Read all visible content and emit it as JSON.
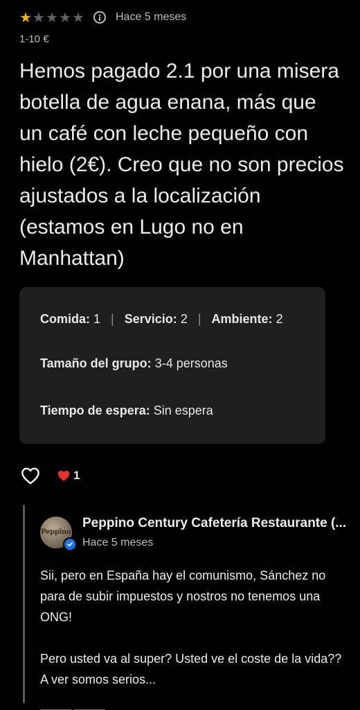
{
  "review": {
    "rating": 1,
    "max_rating": 5,
    "time_ago": "Hace 5 meses",
    "price_range": "1-10 €",
    "text": "Hemos pagado 2.1 por una misera botella de agua enana, más que un café con leche pequeño con hielo (2€). Creo que no son precios ajustados a la localización (estamos en Lugo no en Manhattan)"
  },
  "details": {
    "ratings": [
      {
        "label": "Comida:",
        "value": "1"
      },
      {
        "label": "Servicio:",
        "value": "2"
      },
      {
        "label": "Ambiente:",
        "value": "2"
      }
    ],
    "group_size": {
      "label": "Tamaño del grupo:",
      "value": "3-4 personas"
    },
    "wait_time": {
      "label": "Tiempo de espera:",
      "value": "Sin espera"
    }
  },
  "reactions": {
    "like_icon": "heart-outline-icon",
    "heart_count": "1"
  },
  "owner_reply": {
    "owner_name": "Peppino Century Cafetería Restaurante (...",
    "avatar_text": "Peppino",
    "time_ago": "Hace 5 meses",
    "paragraph_1": "Sii, pero en España hay el comunismo, Sánchez no para de subir impuestos y nostros no tenemos una ONG!",
    "paragraph_2": "Pero usted va al super? Usted ve el coste de la vida?? A ver somos serios..."
  },
  "colors": {
    "star_on": "#f5b400",
    "star_off": "#5f6368",
    "card_bg": "#1f1f1f",
    "heart_red": "#e8322c",
    "verified_blue": "#1a73e8"
  }
}
